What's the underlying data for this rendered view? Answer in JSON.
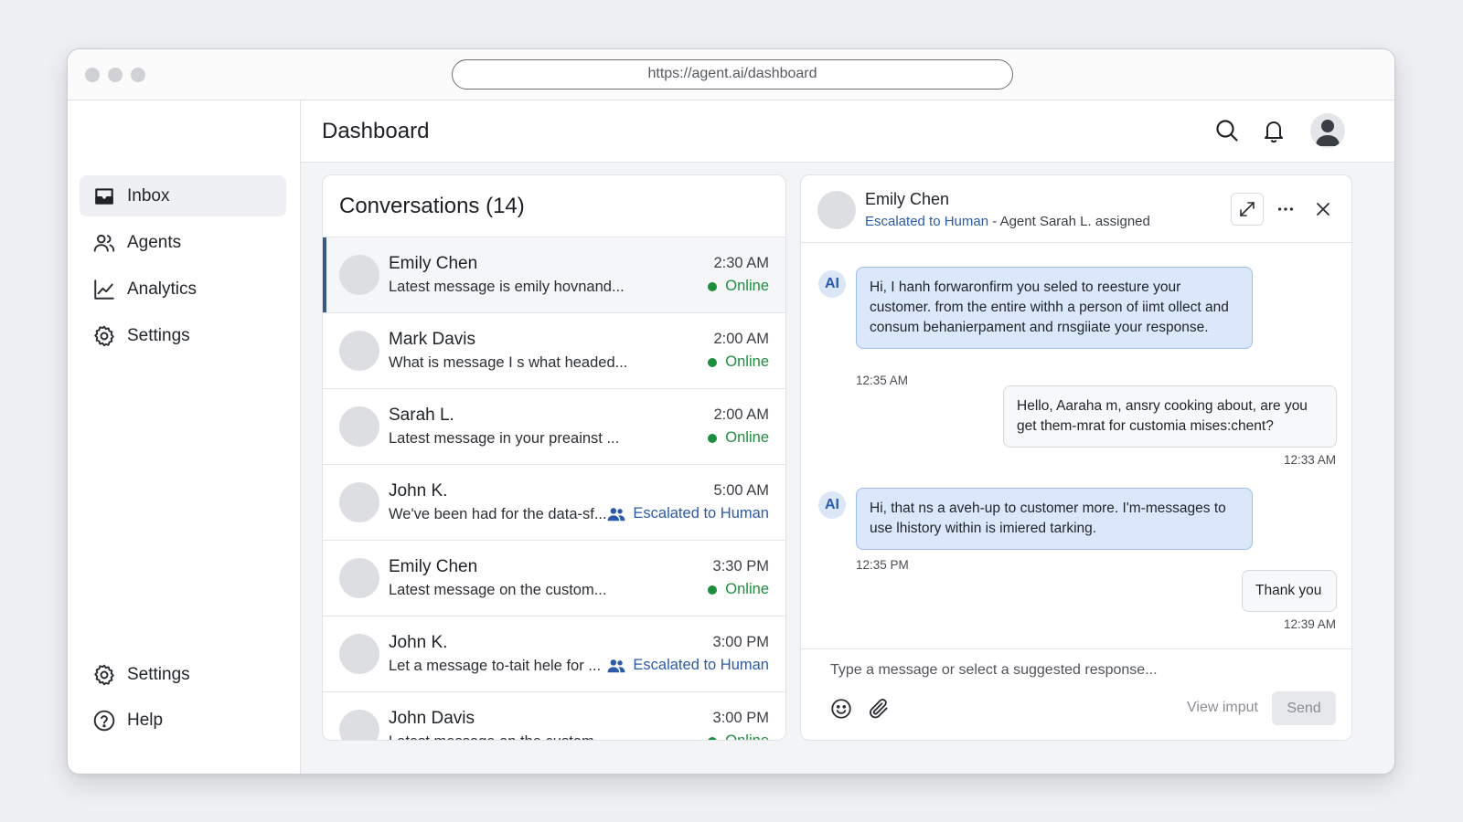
{
  "browser": {
    "url": "https://agent.ai/dashboard"
  },
  "sidebar": {
    "top_items": [
      {
        "label": "Inbox",
        "icon": "inbox-icon",
        "active": true
      },
      {
        "label": "Agents",
        "icon": "users-icon",
        "active": false
      },
      {
        "label": "Analytics",
        "icon": "chart-line-icon",
        "active": false
      },
      {
        "label": "Settings",
        "icon": "gear-icon",
        "active": false
      }
    ],
    "bottom_items": [
      {
        "label": "Settings",
        "icon": "gear-icon"
      },
      {
        "label": "Help",
        "icon": "question-circle-icon"
      }
    ]
  },
  "header": {
    "title": "Dashboard",
    "icons": [
      "search-icon",
      "bell-icon",
      "avatar-icon"
    ]
  },
  "conversations": {
    "title": "Conversations (14)",
    "items": [
      {
        "name": "Emily Chen",
        "message": "Latest message is emily hovnand...",
        "time": "2:30 AM",
        "status": "Online",
        "status_type": "online",
        "selected": true
      },
      {
        "name": "Mark Davis",
        "message": "What is message I s what headed...",
        "time": "2:00 AM",
        "status": "Online",
        "status_type": "online",
        "selected": false
      },
      {
        "name": "Sarah L.",
        "message": "Latest message in your preainst ...",
        "time": "2:00 AM",
        "status": "Online",
        "status_type": "online",
        "selected": false
      },
      {
        "name": "John K.",
        "message": "We've been had for the data-sf...",
        "time": "5:00 AM",
        "status": "Escalated to Human",
        "status_type": "escalated",
        "selected": false
      },
      {
        "name": "Emily Chen",
        "message": "Latest message on the custom...",
        "time": "3:30 PM",
        "status": "Online",
        "status_type": "online",
        "selected": false
      },
      {
        "name": "John K.",
        "message": "Let a message to-tait hele for ...",
        "time": "3:00 PM",
        "status": "Escalated to Human",
        "status_type": "escalated",
        "selected": false
      },
      {
        "name": "John Davis",
        "message": "Latest message on the custom...",
        "time": "3:00 PM",
        "status": "Online",
        "status_type": "online",
        "selected": false
      }
    ]
  },
  "chat": {
    "contact_name": "Emily Chen",
    "status_escalated": "Escalated to Human",
    "status_rest": " - Agent Sarah L. assigned",
    "ai_label": "AI",
    "messages": [
      {
        "from": "ai",
        "text": "Hi, I hanh forwaronfirm you seled to reesture your customer. from the entire withh a person of iimt ollect and consum behanierpament and rnsgiiate your response.",
        "time": "12:35 AM"
      },
      {
        "from": "user",
        "text": "Hello, Aaraha m, ansry cooking about, are you get them-mrat for customia mises:chent?",
        "time": "12:33 AM"
      },
      {
        "from": "ai",
        "text": "Hi, that ns a aveh-up to customer more. I'm-messages to use lhistory within is imiered tarking.",
        "time": "12:35 PM"
      },
      {
        "from": "user",
        "text": "Thank you",
        "time": "12:39 AM"
      }
    ],
    "composer": {
      "placeholder": "Type a message or select a suggested response...",
      "view_input_label": "View imput",
      "send_label": "Send"
    }
  },
  "colors": {
    "accent_blue": "#2b5ba8",
    "online_green": "#1e8e3e",
    "ai_bubble": "#dbe8fb",
    "selected_bar": "#3a5a82"
  }
}
